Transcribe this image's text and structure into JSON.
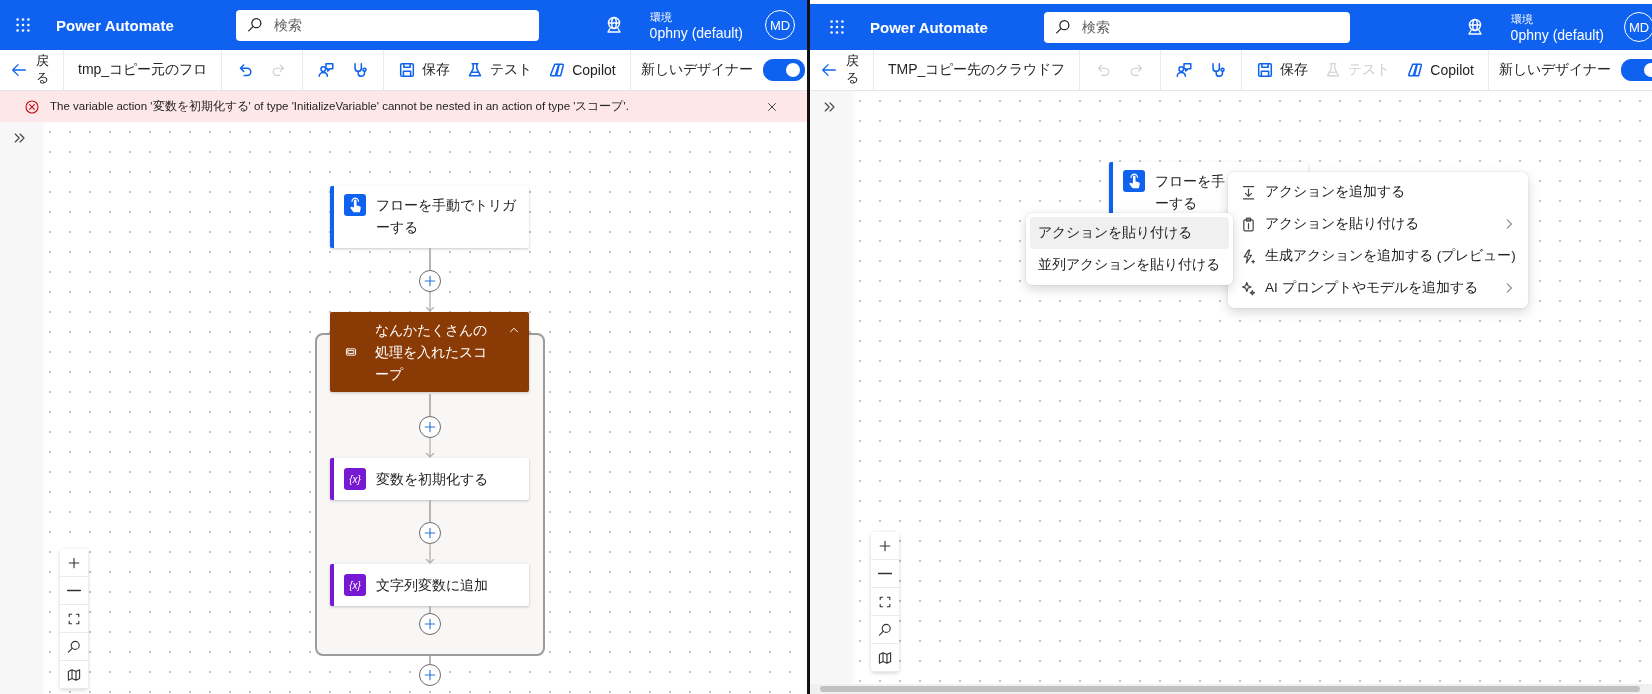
{
  "windows": [
    {
      "app_title": "Power Automate",
      "search": {
        "placeholder": "検索"
      },
      "environment": {
        "label": "環境",
        "name": "0phny (default)"
      },
      "avatar": "MD",
      "toolbar": {
        "back": "戻る",
        "flow_name": "tmp_コピー元のフロ",
        "groups": [
          [
            {
              "kind": "undo",
              "disabled": false
            },
            {
              "kind": "redo",
              "disabled": true
            }
          ],
          [
            {
              "kind": "checker",
              "disabled": false
            },
            {
              "kind": "health",
              "disabled": false
            }
          ],
          [
            {
              "kind": "save",
              "label": "保存",
              "disabled": false
            },
            {
              "kind": "test",
              "label": "テスト",
              "disabled": false
            },
            {
              "kind": "copilot",
              "label": "Copilot",
              "disabled": false
            }
          ]
        ],
        "toggle": {
          "label": "新しいデザイナー",
          "on": true
        }
      },
      "error_banner": {
        "message": "The variable action '変数を初期化する' of type 'InitializeVariable' cannot be nested in an action of type 'スコープ'."
      },
      "flow": {
        "end_add": true,
        "nodes": [
          {
            "kind": "trigger",
            "lines": [
              "フローを手動でトリガ",
              "ーする"
            ]
          },
          {
            "kind": "scope",
            "lines": [
              "なんかたくさんの",
              "処理を入れたスコ",
              "ープ"
            ],
            "expanded": true,
            "children": [
              {
                "kind": "variable",
                "icon_text": "{x}",
                "lines": [
                  "変数を初期化する"
                ]
              },
              {
                "kind": "variable",
                "icon_text": "{x}",
                "lines": [
                  "文字列変数に追加"
                ]
              }
            ]
          }
        ]
      }
    },
    {
      "app_title": "Power Automate",
      "search": {
        "placeholder": "検索"
      },
      "environment": {
        "label": "環境",
        "name": "0phny (default)"
      },
      "avatar": "MD",
      "toolbar": {
        "back": "戻る",
        "flow_name": "TMP_コピー先のクラウドフ",
        "groups": [
          [
            {
              "kind": "undo",
              "disabled": true
            },
            {
              "kind": "redo",
              "disabled": true
            }
          ],
          [
            {
              "kind": "checker",
              "disabled": false
            },
            {
              "kind": "health",
              "disabled": false
            }
          ],
          [
            {
              "kind": "save",
              "label": "保存",
              "disabled": false
            },
            {
              "kind": "test",
              "label": "テスト",
              "disabled": true
            },
            {
              "kind": "copilot",
              "label": "Copilot",
              "disabled": false
            }
          ]
        ],
        "toggle": {
          "label": "新しいデザイナー",
          "on": true
        }
      },
      "flow": {
        "end_add": false,
        "nodes": [
          {
            "kind": "trigger",
            "lines": [
              "フローを手",
              "ーする"
            ]
          }
        ]
      },
      "context_menus": [
        {
          "items": [
            {
              "kind": "add",
              "label": "アクションを追加する",
              "submenu": false
            },
            {
              "kind": "paste",
              "label": "アクションを貼り付ける",
              "submenu": true
            },
            {
              "kind": "generate",
              "label": "生成アクションを追加する (プレビュー)",
              "submenu": false
            },
            {
              "kind": "ai",
              "label": "AI プロンプトやモデルを追加する",
              "submenu": true
            }
          ]
        },
        {
          "items": [
            {
              "label": "アクションを貼り付ける",
              "selected": true
            },
            {
              "label": "並列アクションを貼り付ける",
              "selected": false
            }
          ]
        }
      ]
    }
  ]
}
